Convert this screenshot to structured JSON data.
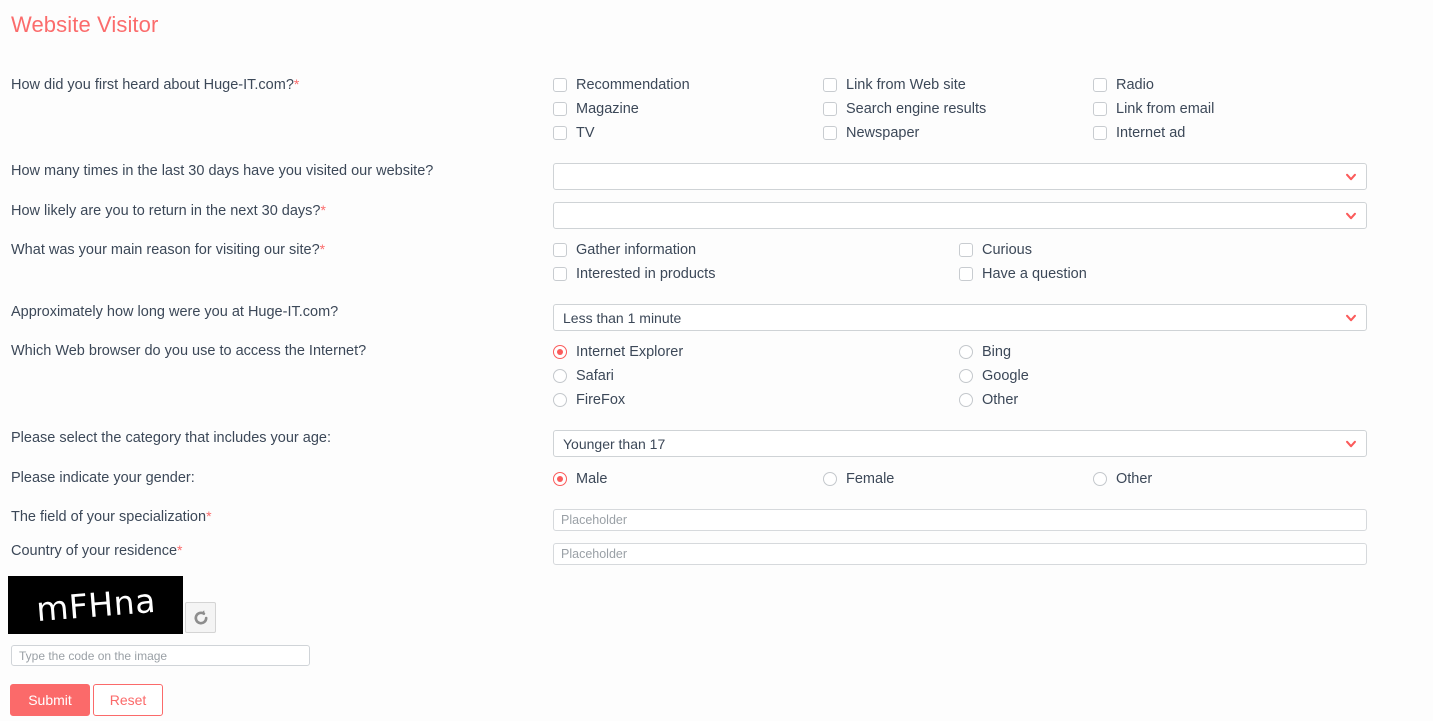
{
  "form": {
    "title": "Website Visitor",
    "required_marker": "*",
    "accent_color": "#fb6c6c",
    "submit_color": "#fb6a6a",
    "background_color": "#fdfdfd",
    "text_color": "#3c4858"
  },
  "questions": {
    "how_heard": {
      "label": "How did you first heard about Huge-IT.com?",
      "required": true,
      "type": "checkbox-group",
      "options": [
        {
          "label": "Recommendation",
          "checked": false
        },
        {
          "label": "Link from Web site",
          "checked": false
        },
        {
          "label": "Radio",
          "checked": false
        },
        {
          "label": "Magazine",
          "checked": false
        },
        {
          "label": "Search engine results",
          "checked": false
        },
        {
          "label": "Link from email",
          "checked": false
        },
        {
          "label": "TV",
          "checked": false
        },
        {
          "label": "Newspaper",
          "checked": false
        },
        {
          "label": "Internet ad",
          "checked": false
        }
      ]
    },
    "visits_30_days": {
      "label": "How many times in the last 30 days have you visited our website?",
      "required": false,
      "type": "select",
      "value": ""
    },
    "likely_return": {
      "label": "How likely are you to return in the next 30 days?",
      "required": true,
      "type": "select",
      "value": ""
    },
    "main_reason": {
      "label": "What was your main reason for visiting our site?",
      "required": true,
      "type": "checkbox-group",
      "options": [
        {
          "label": "Gather information",
          "checked": false
        },
        {
          "label": "Curious",
          "checked": false
        },
        {
          "label": "Interested in products",
          "checked": false
        },
        {
          "label": "Have a question",
          "checked": false
        }
      ]
    },
    "time_on_site": {
      "label": "Approximately how long were you at Huge-IT.com?",
      "required": false,
      "type": "select",
      "value": "Less than 1 minute"
    },
    "web_browser": {
      "label": "Which Web browser do you use to access the Internet?",
      "required": false,
      "type": "radio-group",
      "options": [
        {
          "label": "Internet Explorer",
          "checked": true
        },
        {
          "label": "Bing",
          "checked": false
        },
        {
          "label": "Safari",
          "checked": false
        },
        {
          "label": "Google",
          "checked": false
        },
        {
          "label": "FireFox",
          "checked": false
        },
        {
          "label": "Other",
          "checked": false
        }
      ]
    },
    "age_category": {
      "label": "Please select the category that includes your age:",
      "required": false,
      "type": "select",
      "value": "Younger than 17"
    },
    "gender": {
      "label": "Please indicate your gender:",
      "required": false,
      "type": "radio-group",
      "options": [
        {
          "label": "Male",
          "checked": true
        },
        {
          "label": "Female",
          "checked": false
        },
        {
          "label": "Other",
          "checked": false
        }
      ]
    },
    "specialization": {
      "label": "The field of your specialization",
      "required": true,
      "type": "text",
      "value": "",
      "placeholder": "Placeholder"
    },
    "country": {
      "label": "Country of your residence",
      "required": true,
      "type": "text",
      "value": "",
      "placeholder": "Placeholder"
    }
  },
  "captcha": {
    "code_text": "mFHna",
    "reload_icon": "refresh-icon",
    "input_value": "",
    "input_placeholder": "Type the code on the image"
  },
  "actions": {
    "submit_label": "Submit",
    "reset_label": "Reset"
  },
  "icons": {
    "chevron": "chevron-down-icon",
    "refresh": "refresh-icon"
  }
}
